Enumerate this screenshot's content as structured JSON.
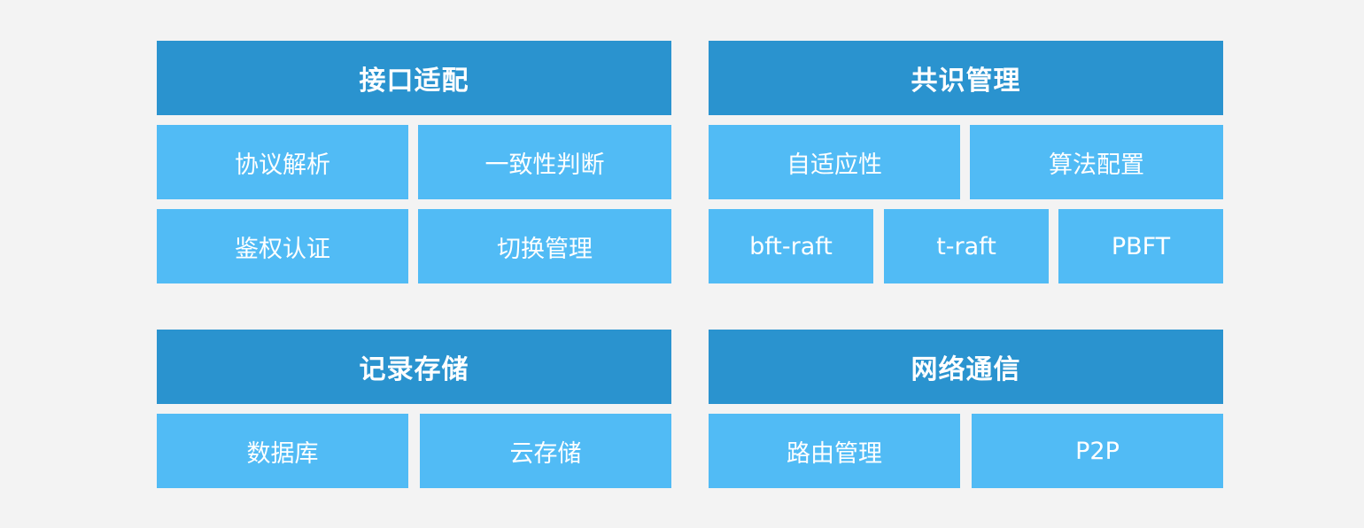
{
  "interface_adapter": {
    "title": "接口适配",
    "items": [
      "协议解析",
      "一致性判断",
      "鉴权认证",
      "切换管理"
    ]
  },
  "consensus_management": {
    "title": "共识管理",
    "items": [
      "自适应性",
      "算法配置",
      "bft-raft",
      "t-raft",
      "PBFT"
    ]
  },
  "record_storage": {
    "title": "记录存储",
    "items": [
      "数据库",
      "云存储"
    ]
  },
  "network_communication": {
    "title": "网络通信",
    "items": [
      "路由管理",
      "P2P"
    ]
  },
  "colors": {
    "background": "#f3f3f3",
    "header": "#2a93cf",
    "cell": "#51bbf5",
    "text": "#ffffff"
  }
}
